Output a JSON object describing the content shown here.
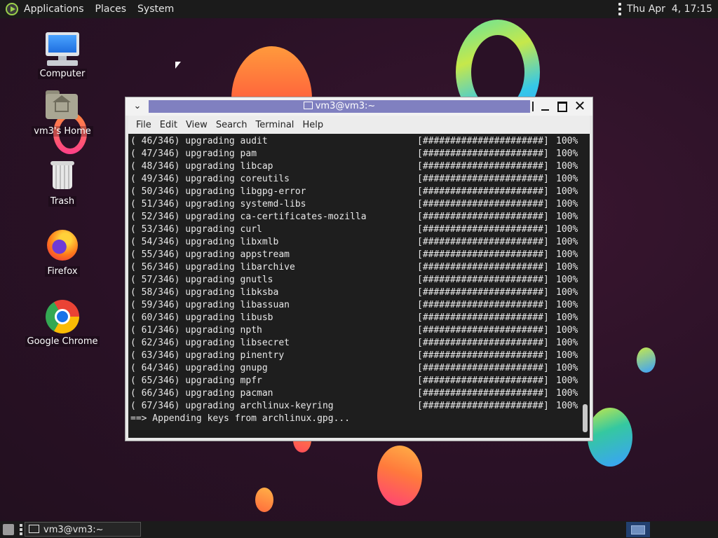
{
  "top_panel": {
    "applications": "Applications",
    "places": "Places",
    "system": "System",
    "clock": "Thu Apr  4, 17:15"
  },
  "desktop": {
    "icons": [
      {
        "label": "Computer",
        "icon": "computer-icon"
      },
      {
        "label": "vm3's Home",
        "icon": "home-folder-icon"
      },
      {
        "label": "Trash",
        "icon": "trash-icon"
      },
      {
        "label": "Firefox",
        "icon": "firefox-icon"
      },
      {
        "label": "Google Chrome",
        "icon": "chrome-icon"
      }
    ]
  },
  "window": {
    "title": "vm3@vm3:~",
    "menu": [
      "File",
      "Edit",
      "View",
      "Search",
      "Terminal",
      "Help"
    ]
  },
  "terminal": {
    "progress_bar": "[######################]",
    "lines": [
      {
        "n": "( 46/346)",
        "text": "upgrading audit",
        "pct": "100%"
      },
      {
        "n": "( 47/346)",
        "text": "upgrading pam",
        "pct": "100%"
      },
      {
        "n": "( 48/346)",
        "text": "upgrading libcap",
        "pct": "100%"
      },
      {
        "n": "( 49/346)",
        "text": "upgrading coreutils",
        "pct": "100%"
      },
      {
        "n": "( 50/346)",
        "text": "upgrading libgpg-error",
        "pct": "100%"
      },
      {
        "n": "( 51/346)",
        "text": "upgrading systemd-libs",
        "pct": "100%"
      },
      {
        "n": "( 52/346)",
        "text": "upgrading ca-certificates-mozilla",
        "pct": "100%"
      },
      {
        "n": "( 53/346)",
        "text": "upgrading curl",
        "pct": "100%"
      },
      {
        "n": "( 54/346)",
        "text": "upgrading libxmlb",
        "pct": "100%"
      },
      {
        "n": "( 55/346)",
        "text": "upgrading appstream",
        "pct": "100%"
      },
      {
        "n": "( 56/346)",
        "text": "upgrading libarchive",
        "pct": "100%"
      },
      {
        "n": "( 57/346)",
        "text": "upgrading gnutls",
        "pct": "100%"
      },
      {
        "n": "( 58/346)",
        "text": "upgrading libksba",
        "pct": "100%"
      },
      {
        "n": "( 59/346)",
        "text": "upgrading libassuan",
        "pct": "100%"
      },
      {
        "n": "( 60/346)",
        "text": "upgrading libusb",
        "pct": "100%"
      },
      {
        "n": "( 61/346)",
        "text": "upgrading npth",
        "pct": "100%"
      },
      {
        "n": "( 62/346)",
        "text": "upgrading libsecret",
        "pct": "100%"
      },
      {
        "n": "( 63/346)",
        "text": "upgrading pinentry",
        "pct": "100%"
      },
      {
        "n": "( 64/346)",
        "text": "upgrading gnupg",
        "pct": "100%"
      },
      {
        "n": "( 65/346)",
        "text": "upgrading mpfr",
        "pct": "100%"
      },
      {
        "n": "( 66/346)",
        "text": "upgrading pacman",
        "pct": "100%"
      },
      {
        "n": "( 67/346)",
        "text": "upgrading archlinux-keyring",
        "pct": "100%"
      }
    ],
    "last_line": "==> Appending keys from archlinux.gpg..."
  },
  "bottom_panel": {
    "task_label": "vm3@vm3:~"
  },
  "colors": {
    "title_active": "#8080c0",
    "terminal_bg": "#1e1e1e",
    "panel_bg": "#1b1b1b"
  }
}
